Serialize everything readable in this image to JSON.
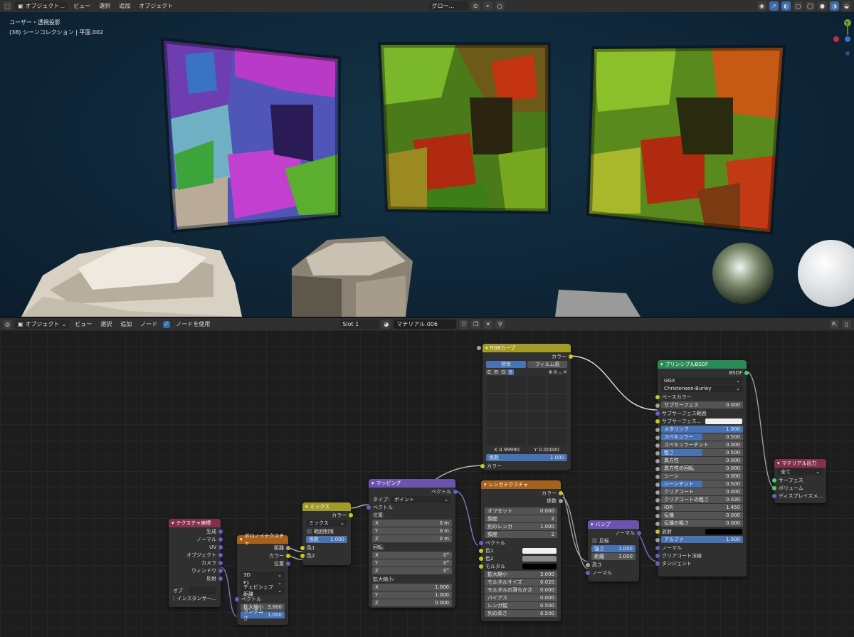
{
  "top_header": {
    "mode": "オブジェクト...",
    "menus": [
      "ビュー",
      "選択",
      "追加",
      "オブジェクト"
    ],
    "transform": "グロー..."
  },
  "viewport": {
    "line1": "ユーザー・透視投影",
    "line2": "(38) シーンコレクション | 平面.002",
    "axis_y": "Y"
  },
  "node_header": {
    "mode": "オブジェクト",
    "menus": [
      "ビュー",
      "選択",
      "追加",
      "ノード"
    ],
    "use_nodes_label": "ノードを使用",
    "slot": "Slot 1",
    "material": "マテリアル.006"
  },
  "nodes": {
    "texcoord": {
      "title": "テクスチャ座標",
      "outputs": [
        "生成",
        "ノーマル",
        "UV",
        "オブジェクト",
        "カメラ",
        "ウィンドウ",
        "反射"
      ],
      "object_label": "オブ",
      "instancer": "インスタンサー..."
    },
    "voronoi": {
      "title": "ボロノイテクスチャ",
      "outputs": [
        "距離",
        "カラー",
        "位置"
      ],
      "dim": "3D",
      "feature": "F1",
      "metric": "チェビシェフ距離",
      "vector": "ベクトル",
      "scale_label": "拡大縮小",
      "scale": "3.800",
      "rand_label": "ランダムさ",
      "rand": "1.000"
    },
    "mix": {
      "title": "ミックス",
      "out": "カラー",
      "blend": "ミックス",
      "clamp": "範囲制限",
      "fac_label": "係数",
      "fac": "1.000",
      "in1": "色1",
      "in2": "色2"
    },
    "mapping": {
      "title": "マッピング",
      "out": "ベクトル",
      "type_label": "タイプ:",
      "type": "ポイント",
      "vector": "ベクトル",
      "loc": "位置:",
      "rot": "回転:",
      "scl": "拡大縮小:",
      "loc_v": [
        "0 m",
        "0 m",
        "0 m"
      ],
      "rot_v": [
        "0°",
        "0°",
        "0°"
      ],
      "scl_v": [
        "1.000",
        "1.000",
        "0.000"
      ],
      "xyz": [
        "X",
        "Y",
        "Z"
      ]
    },
    "rgb": {
      "title": "RGBカーブ",
      "out": "カラー",
      "tab1": "標準",
      "tab2": "フィルム風",
      "chans": [
        "C",
        "R",
        "G",
        "B"
      ],
      "xval": "X 0.99990",
      "yval": "Y 0.00000",
      "fac_label": "係数",
      "fac": "1.000",
      "in": "カラー"
    },
    "brick": {
      "title": "レンガテクスチャ",
      "outs": [
        "カラー",
        "係数"
      ],
      "fields": [
        [
          "オフセット",
          "0.000"
        ],
        [
          "頻度",
          "2"
        ],
        [
          "別のレンガ",
          "1.000"
        ],
        [
          "頻度",
          "2"
        ]
      ],
      "vector": "ベクトル",
      "c1": "色1",
      "c2": "色2",
      "mortar": "モルタル",
      "params": [
        [
          "拡大縮小",
          "3.000"
        ],
        [
          "モルタルサイズ",
          "0.020"
        ],
        [
          "モルタルの滑らかさ",
          "0.000"
        ],
        [
          "バイアス",
          "0.000"
        ],
        [
          "レンガ幅",
          "0.500"
        ],
        [
          "列の高さ",
          "0.500"
        ]
      ]
    },
    "bump": {
      "title": "バンプ",
      "out": "ノーマル",
      "invert": "反転",
      "str_label": "強さ",
      "str": "1.000",
      "dist_label": "距離",
      "dist": "1.000",
      "h": "高さ",
      "n": "ノーマル"
    },
    "bsdf": {
      "title": "プリンシプルBSDF",
      "out": "BSDF",
      "dist": "GGX",
      "sss": "Christensen-Burley",
      "base": "ベースカラー",
      "rows": [
        [
          "サブサーフェス",
          "0.000"
        ],
        [
          "サブサーフェス範囲",
          ""
        ],
        [
          "サブサーフェス...",
          ""
        ],
        [
          "メタリック",
          "1.000"
        ],
        [
          "スペキュラー",
          "0.500"
        ],
        [
          "スペキュラーチント",
          "0.000"
        ],
        [
          "粗さ",
          "0.500"
        ],
        [
          "異方性",
          "0.000"
        ],
        [
          "異方性の回転",
          "0.000"
        ],
        [
          "シーン",
          "0.000"
        ],
        [
          "シーンチント",
          "0.500"
        ],
        [
          "クリアコート",
          "0.000"
        ],
        [
          "クリアコートの粗さ",
          "0.030"
        ],
        [
          "IOR",
          "1.450"
        ],
        [
          "伝播",
          "0.000"
        ],
        [
          "伝播の粗さ",
          "0.000"
        ],
        [
          "放射",
          ""
        ],
        [
          "アルファ",
          "1.000"
        ],
        [
          "ノーマル",
          ""
        ],
        [
          "クリアコート法線",
          ""
        ],
        [
          "タンジェント",
          ""
        ]
      ]
    },
    "output": {
      "title": "マテリアル出力",
      "target": "全て",
      "ins": [
        "サーフェス",
        "ボリューム",
        "ディスプレイスメ..."
      ]
    }
  },
  "colors": {
    "accent": "#4772b3",
    "header_input": "#83314a",
    "header_color": "#a6621c",
    "header_vector": "#6a54b0",
    "header_shader": "#2b8a55",
    "header_converter": "#a39a28"
  }
}
